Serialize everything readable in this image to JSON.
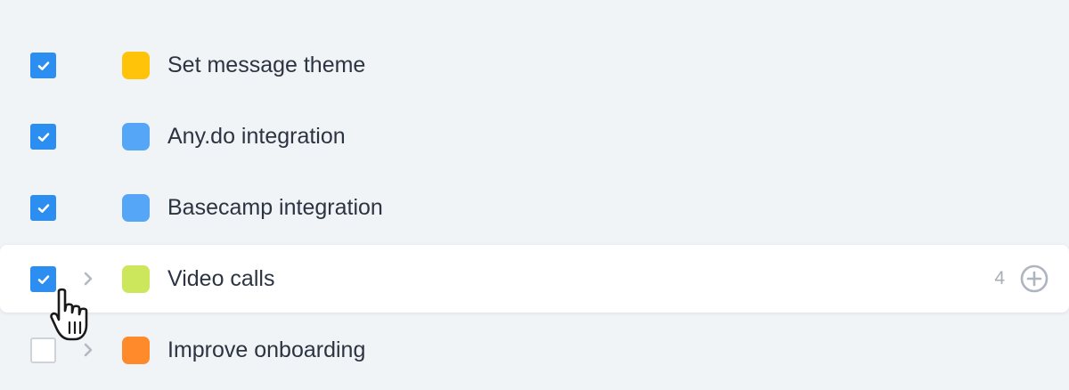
{
  "tasks": [
    {
      "label": "Set message theme",
      "checked": true,
      "color": "#ffc40a",
      "has_subtasks": false
    },
    {
      "label": "Any.do integration",
      "checked": true,
      "color": "#55a6f7",
      "has_subtasks": false
    },
    {
      "label": "Basecamp integration",
      "checked": true,
      "color": "#55a6f7",
      "has_subtasks": false
    },
    {
      "label": "Video calls",
      "checked": true,
      "color": "#cde75c",
      "has_subtasks": true,
      "count": "4"
    },
    {
      "label": "Improve onboarding",
      "checked": false,
      "color": "#ff8a2c",
      "has_subtasks": true
    }
  ],
  "colors": {
    "accent": "#2b8ef0",
    "background": "#f1f4f7",
    "text": "#2c3442",
    "muted": "#a7aeb8"
  },
  "icons": {
    "checkbox": "check-icon",
    "expand": "chevron-right-icon",
    "add": "plus-circle-icon",
    "cursor": "hand-pointer-cursor"
  }
}
